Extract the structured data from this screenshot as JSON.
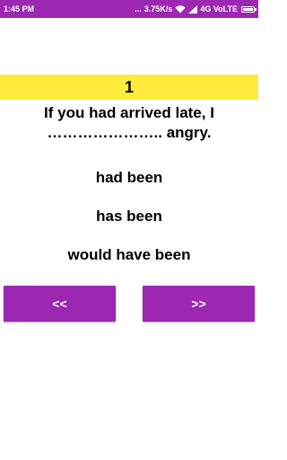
{
  "status_bar": {
    "time": "1:45 PM",
    "dots": "...",
    "network_speed": "3.75K/s",
    "network_type": "4G VoLTE",
    "icons": [
      "wifi-icon",
      "signal-icon",
      "battery-icon"
    ]
  },
  "quiz": {
    "number": "1",
    "question_line1": "If you had arrived late, I",
    "question_line2": "………………….. angry.",
    "options": [
      "had been",
      "has been",
      "would have been"
    ]
  },
  "navigation": {
    "prev_label": "<<",
    "next_label": ">>"
  },
  "colors": {
    "accent": "#9c27b0",
    "highlight": "#ffeb3b"
  }
}
